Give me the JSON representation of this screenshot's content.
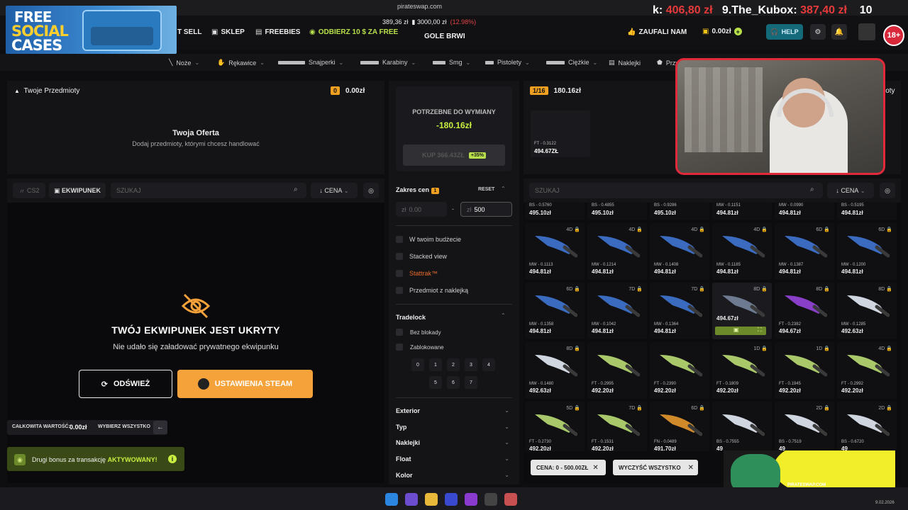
{
  "browser": {
    "url": "pirateswap.com"
  },
  "promo_logo": {
    "line1": "FREE",
    "line2": "SOCIAL",
    "line3": "CASES"
  },
  "header": {
    "nav": {
      "sell": "T SELL",
      "shop": "SKLEP",
      "freebies": "FREEBIES",
      "promo": "ODBIERZ 10 $ ZA FREE"
    },
    "balance_line": {
      "a": "389,36 zł",
      "b": "3000,00 zł",
      "pct": "(12.98%)"
    },
    "stream_title": "GOLE BRWI",
    "trusted": "ZAUFALI NAM",
    "wallet": "0.00zł",
    "help": "HELP",
    "age": "18+"
  },
  "stream_overlay": {
    "left_label": "k:",
    "left_amt": "406,80 zł",
    "rank": "9.The_Kubox:",
    "rank_amt": "387,40 zł",
    "right": "10"
  },
  "categories": [
    "Noże",
    "Rękawice",
    "Snajperki",
    "Karabiny",
    "Smg",
    "Pistolety",
    "Ciężkie",
    "Naklejki",
    "Przy"
  ],
  "left": {
    "title": "Twoje Przedmioty",
    "count": "0",
    "total": "0.00zł",
    "offer_title": "Twoja Oferta",
    "offer_sub": "Dodaj przedmioty, którymi chcesz handlować",
    "game_chip": "CS2",
    "inv_tab": "EKWIPUNEK",
    "search_placeholder": "SZUKAJ",
    "sort": "CENA",
    "hidden_title": "TWÓJ EKWIPUNEK JEST UKRYTY",
    "hidden_sub": "Nie udało się załadować prywatnego ekwipunku",
    "refresh": "ODŚWIEŻ",
    "steam": "USTAWIENIA STEAM",
    "total_label": "CAŁKOWITA WARTOŚĆ:",
    "total_value": "0.00zł",
    "select_all": "WYBIERZ WSZYSTKO",
    "bonus_pre": "Drugi bonus za transakcję",
    "bonus_state": "AKTYWOWANY!"
  },
  "middle": {
    "need_label": "POTRZEBNE DO WYMIANY",
    "need_value": "-180.16zł",
    "buy_label": "KUP 366.43ZŁ",
    "buy_badge": "+35%",
    "range_label": "Zakres cen",
    "range_count": "1",
    "reset": "RESET",
    "min_placeholder": "0.00",
    "max_value": "500",
    "currency": "zł",
    "dash": "-",
    "filters": [
      "W twoim budżecie",
      "Stacked view",
      "Stattrak™",
      "Przedmiot z naklejką"
    ],
    "tradelock_label": "Tradelock",
    "tradelock_opts": [
      "Bez blokady",
      "Zablokowane"
    ],
    "days": [
      "0",
      "1",
      "2",
      "3",
      "4",
      "5",
      "6",
      "7"
    ],
    "sections": [
      "Exterior",
      "Typ",
      "Naklejki",
      "Float",
      "Kolor"
    ]
  },
  "right": {
    "page": "1/16",
    "total": "180.16zł",
    "selected_wear": "FT - 0.3122",
    "selected_price": "494.67ZŁ",
    "cut_label": "ioty",
    "search_placeholder": "SZUKAJ",
    "sort": "CENA",
    "row0": [
      {
        "wear": "BS - 0.5760",
        "price": "495.10zł"
      },
      {
        "wear": "BS - 0.4855",
        "price": "495.10zł"
      },
      {
        "wear": "BS - 0.9286",
        "price": "495.10zł"
      },
      {
        "wear": "MW - 0.1151",
        "price": "494.81zł"
      },
      {
        "wear": "MW - 0.0990",
        "price": "494.81zł"
      },
      {
        "wear": "BS - 0.5195",
        "price": "494.81zł"
      }
    ],
    "row1": [
      {
        "lock": "4D",
        "wear": "MW - 0.1113",
        "price": "494.81zł",
        "color": "#3a6bbf"
      },
      {
        "lock": "4D",
        "wear": "MW - 0.1214",
        "price": "494.81zł",
        "color": "#3a6bbf"
      },
      {
        "lock": "4D",
        "wear": "MW - 0.1408",
        "price": "494.81zł",
        "color": "#3a6bbf"
      },
      {
        "lock": "4D",
        "wear": "MW - 0.1185",
        "price": "494.81zł",
        "color": "#3a6bbf"
      },
      {
        "lock": "6D",
        "wear": "MW - 0.1387",
        "price": "494.81zł",
        "color": "#3a6bbf"
      },
      {
        "lock": "6D",
        "wear": "MW - 0.1200",
        "price": "494.81zł",
        "color": "#3a6bbf"
      }
    ],
    "row2": [
      {
        "lock": "6D",
        "wear": "MW - 0.1358",
        "price": "494.81zł",
        "color": "#3a6bbf"
      },
      {
        "lock": "7D",
        "wear": "MW - 0.1042",
        "price": "494.81zł",
        "color": "#3a6bbf"
      },
      {
        "lock": "7D",
        "wear": "MW - 0.1364",
        "price": "494.81zł",
        "color": "#3a6bbf"
      },
      {
        "lock": "8D",
        "wear": "",
        "price": "494.67zł",
        "color": "#6d7a90"
      },
      {
        "lock": "8D",
        "wear": "FT - 0.2382",
        "price": "494.67zł",
        "color": "#8a3fc9"
      },
      {
        "lock": "8D",
        "wear": "MW - 0.1285",
        "price": "492.63zł",
        "color": "#cfd6e0"
      }
    ],
    "row3": [
      {
        "lock": "8D",
        "wear": "MW - 0.1480",
        "price": "492.63zł",
        "color": "#cfd6e0"
      },
      {
        "lock": "",
        "wear": "FT - 0.2995",
        "price": "492.20zł",
        "color": "#a8c86a"
      },
      {
        "lock": "",
        "wear": "FT - 0.2390",
        "price": "492.20zł",
        "color": "#a8c86a"
      },
      {
        "lock": "1D",
        "wear": "FT - 0.1809",
        "price": "492.20zł",
        "color": "#a8c86a"
      },
      {
        "lock": "1D",
        "wear": "FT - 0.1945",
        "price": "492.20zł",
        "color": "#a8c86a"
      },
      {
        "lock": "4D",
        "wear": "FT - 0.2992",
        "price": "492.20zł",
        "color": "#a8c86a"
      }
    ],
    "row4": [
      {
        "lock": "5D",
        "wear": "FT - 0.2730",
        "price": "492.20zł",
        "color": "#a8c86a"
      },
      {
        "lock": "7D",
        "wear": "FT - 0.1531",
        "price": "492.20zł",
        "color": "#a8c86a"
      },
      {
        "lock": "6D",
        "wear": "FN - 0.0489",
        "price": "491.70zł",
        "color": "#d08a2a"
      },
      {
        "lock": "",
        "wear": "BS - 0.7555",
        "price": "49",
        "color": "#cfd6e0"
      },
      {
        "lock": "2D",
        "wear": "BS - 0.7519",
        "price": "49",
        "color": "#cfd6e0"
      },
      {
        "lock": "2D",
        "wear": "BS - 0.6720",
        "price": "49",
        "color": "#cfd6e0"
      }
    ],
    "filter_chip": "CENA: 0 - 500.00ZŁ",
    "clear_all": "WYCZYŚĆ WSZYSTKO"
  },
  "bottom_sticker": {
    "site": "PIRATESWAP.COM"
  },
  "taskbar": {
    "date": "9.02.2026"
  }
}
